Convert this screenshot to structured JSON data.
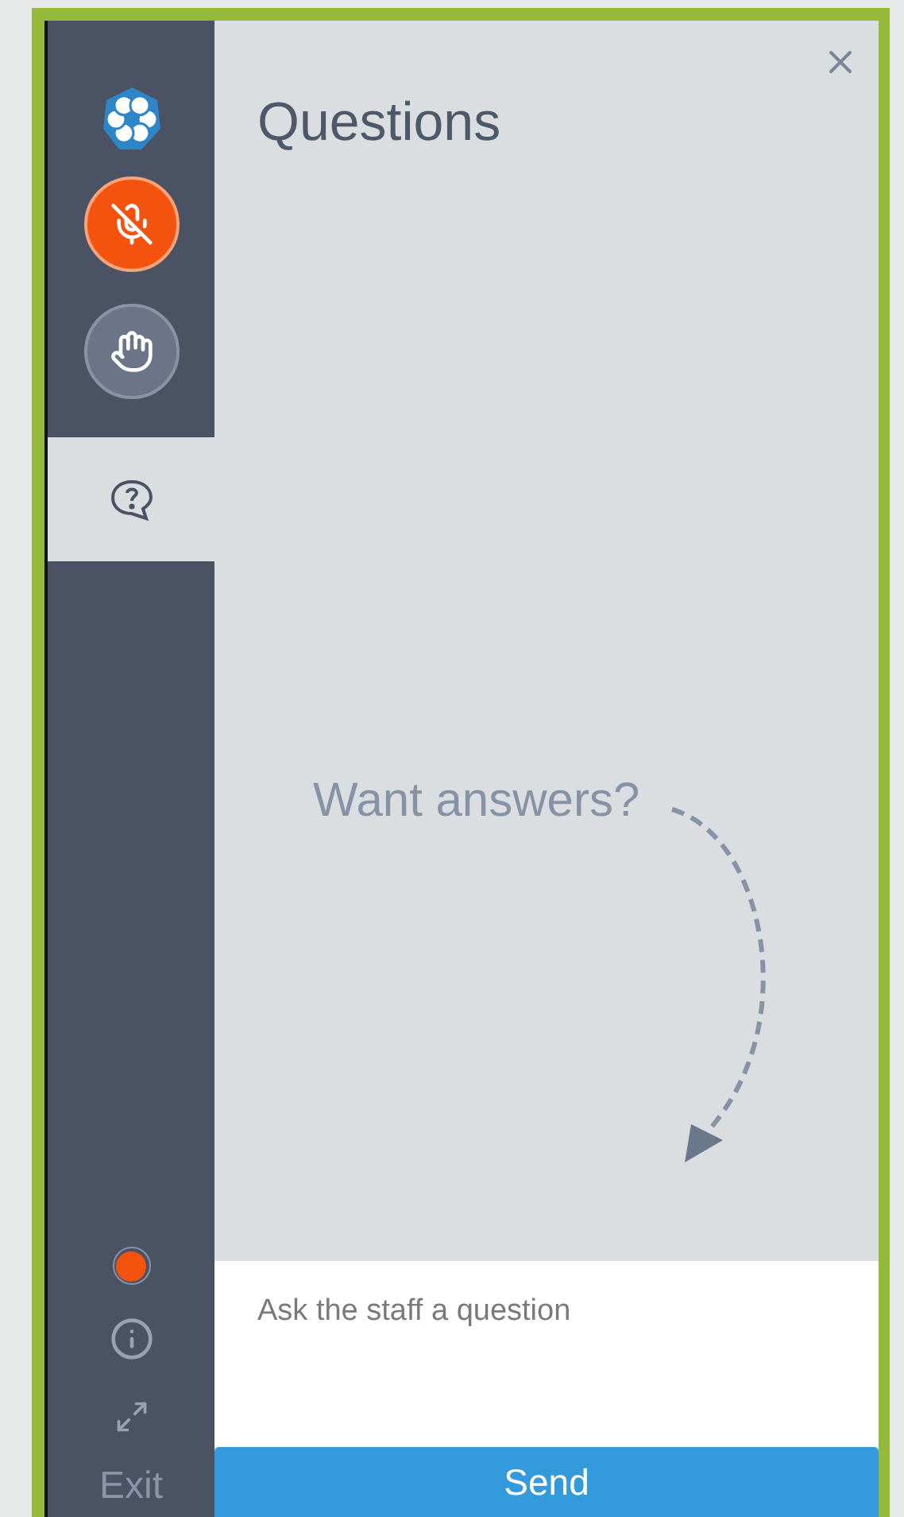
{
  "sidebar": {
    "buttons": [
      {
        "kind": "mic",
        "muted": true
      },
      {
        "kind": "hand"
      }
    ],
    "tabs": [
      {
        "kind": "questions",
        "selected": true
      }
    ],
    "status_dot": {
      "color": "#f4520f"
    },
    "exit": "Exit"
  },
  "panel": {
    "title": "Questions",
    "hint": "Want answers?",
    "input": {
      "placeholder": "Ask the staff a question"
    },
    "send": "Send"
  }
}
